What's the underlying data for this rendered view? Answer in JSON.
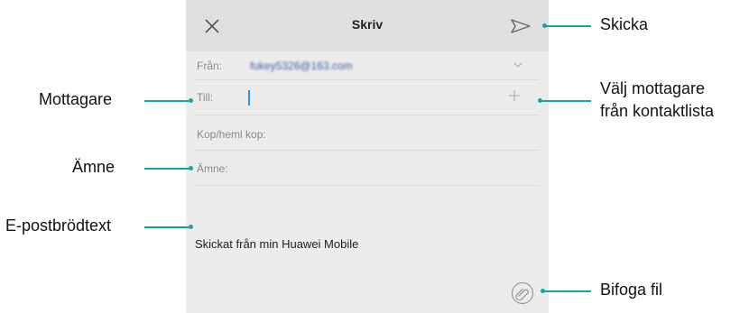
{
  "compose": {
    "title": "Skriv",
    "from_label": "Från:",
    "from_value": "fukey5326@163.com",
    "to_label": "Till:",
    "cc_label": "Kop/heml kop:",
    "subject_label": "Ämne:",
    "body_text": "Skickat från min Huawei Mobile"
  },
  "icons": {
    "close": "close-icon",
    "send": "send-icon",
    "chevron": "chevron-down-icon",
    "add": "plus-icon",
    "attach": "paperclip-icon"
  },
  "callouts": {
    "send": "Skicka",
    "recipient": "Mottagare",
    "choose_recipient_line1": "Välj mottagare",
    "choose_recipient_line2": "från kontaktlista",
    "subject": "Ämne",
    "body": "E-postbrödtext",
    "attach": "Bifoga fil"
  },
  "colors": {
    "accent": "#1aa3a3",
    "caret": "#2196f3"
  }
}
